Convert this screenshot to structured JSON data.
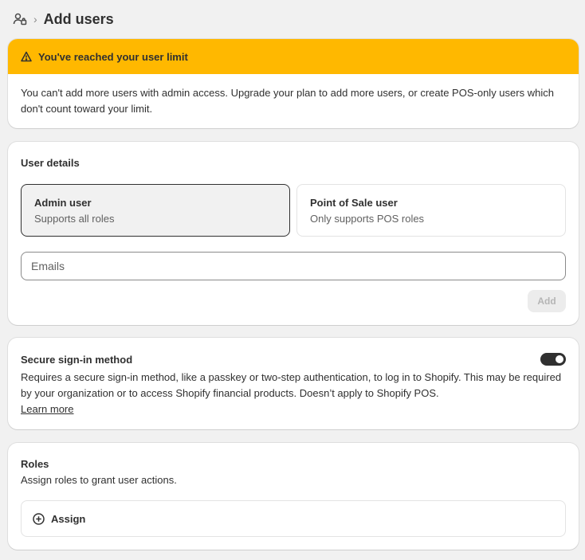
{
  "header": {
    "icon": "users-icon",
    "separator": "›",
    "title": "Add users"
  },
  "banner": {
    "icon": "warning-icon",
    "title": "You've reached your user limit",
    "body": "You can't add more users with admin access. Upgrade your plan to add more users, or create POS-only users which don't count toward your limit.",
    "color": "#ffb800"
  },
  "user_details": {
    "title": "User details",
    "options": [
      {
        "title": "Admin user",
        "subtitle": "Supports all roles",
        "selected": true
      },
      {
        "title": "Point of Sale user",
        "subtitle": "Only supports POS roles",
        "selected": false
      }
    ],
    "emails_placeholder": "Emails",
    "add_label": "Add"
  },
  "secure_signin": {
    "title": "Secure sign-in method",
    "description": "Requires a secure sign-in method, like a passkey or two-step authentication, to log in to Shopify. This may be required by your organization or to access Shopify financial products. Doesn’t apply to Shopify POS.",
    "learn_more": "Learn more",
    "toggle_on": true
  },
  "roles": {
    "title": "Roles",
    "subtitle": "Assign roles to grant user actions.",
    "assign_label": "Assign",
    "assign_icon": "plus-circle-icon"
  }
}
